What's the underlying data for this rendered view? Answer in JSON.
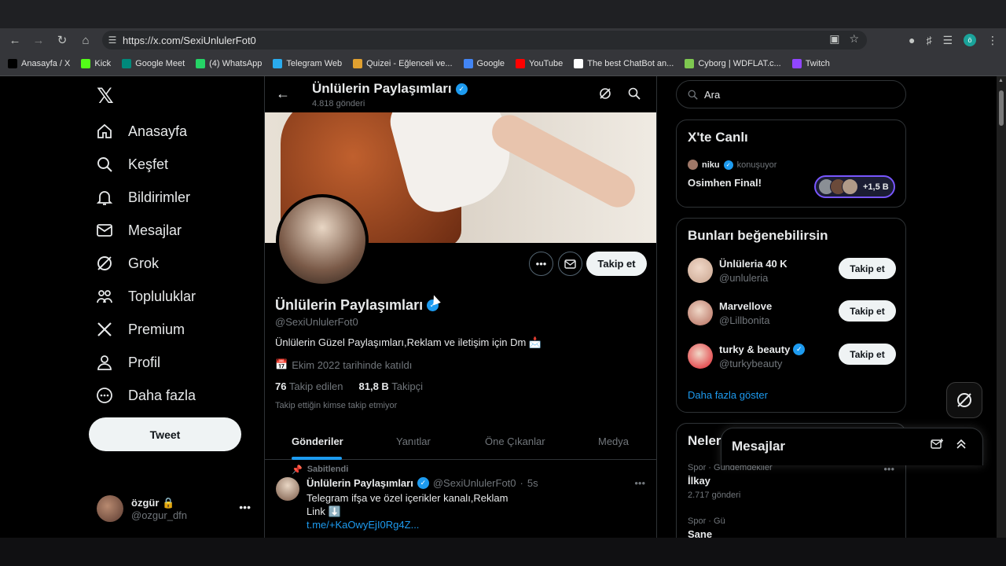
{
  "browser": {
    "url": "https://x.com/SexiUnlulerFot0",
    "profile_initial": "ö",
    "bookmarks": [
      {
        "label": "Anasayfa / X",
        "icon": "x-logo-icon",
        "color": "#000000"
      },
      {
        "label": "Kick",
        "icon": "kick-icon",
        "color": "#53fc18"
      },
      {
        "label": "Google Meet",
        "icon": "meet-icon",
        "color": "#00897b"
      },
      {
        "label": "(4) WhatsApp",
        "icon": "whatsapp-icon",
        "color": "#25d366"
      },
      {
        "label": "Telegram Web",
        "icon": "telegram-icon",
        "color": "#2aabee"
      },
      {
        "label": "Quizei - Eğlenceli ve...",
        "icon": "quizei-icon",
        "color": "#e0a030"
      },
      {
        "label": "Google",
        "icon": "google-icon",
        "color": "#4285f4"
      },
      {
        "label": "YouTube",
        "icon": "youtube-icon",
        "color": "#ff0000"
      },
      {
        "label": "The best ChatBot an...",
        "icon": "chatbot-icon",
        "color": "#ffffff"
      },
      {
        "label": "Cyborg | WDFLAT.c...",
        "icon": "cyborg-icon",
        "color": "#7ec850"
      },
      {
        "label": "Twitch",
        "icon": "twitch-icon",
        "color": "#9146ff"
      }
    ]
  },
  "nav": {
    "items": [
      {
        "label": "Anasayfa",
        "icon": "home-icon"
      },
      {
        "label": "Keşfet",
        "icon": "search-icon"
      },
      {
        "label": "Bildirimler",
        "icon": "bell-icon"
      },
      {
        "label": "Mesajlar",
        "icon": "mail-icon"
      },
      {
        "label": "Grok",
        "icon": "grok-icon"
      },
      {
        "label": "Topluluklar",
        "icon": "communities-icon"
      },
      {
        "label": "Premium",
        "icon": "x-premium-icon"
      },
      {
        "label": "Profil",
        "icon": "person-icon"
      },
      {
        "label": "Daha fazla",
        "icon": "more-circle-icon"
      }
    ],
    "tweet_label": "Tweet",
    "account": {
      "name": "özgür",
      "handle": "@ozgur_dfn"
    }
  },
  "profile": {
    "header_name": "Ünlülerin Paylaşımları",
    "post_count": "4.818 gönderi",
    "name": "Ünlülerin Paylaşımları",
    "handle": "@SexiUnlulerFot0",
    "bio": "Ünlülerin Güzel Paylaşımları,Reklam ve iletişim için Dm 📩",
    "joined": "Ekim 2022 tarihinde katıldı",
    "following_count": "76",
    "following_label": "Takip edilen",
    "followers_count": "81,8 B",
    "followers_label": "Takipçi",
    "mutual_note": "Takip ettiğin kimse takip etmiyor",
    "follow_label": "Takip et",
    "tabs": [
      "Gönderiler",
      "Yanıtlar",
      "Öne Çıkanlar",
      "Medya"
    ]
  },
  "post": {
    "pinned_label": "Sabitlendi",
    "author": "Ünlülerin Paylaşımları",
    "handle": "@SexiUnlulerFot0",
    "time": "5s",
    "line1": "Telegram ifşa ve özel içerikler kanalı,Reklam",
    "line2": "Link ⬇️",
    "link": "t.me/+KaOwyEjI0Rg4Z..."
  },
  "right": {
    "search_placeholder": "Ara",
    "live": {
      "title": "X'te Canlı",
      "host": "niku",
      "host_status": "konuşuyor",
      "space_title": "Osimhen Final!",
      "listeners": "+1,5 B"
    },
    "suggestions": {
      "title": "Bunları beğenebilirsin",
      "items": [
        {
          "name": "Ünlüleria 40 K",
          "handle": "@unluleria",
          "verified": false,
          "color": "#c9a48e"
        },
        {
          "name": "Marvellove",
          "handle": "@Lillbonita",
          "verified": false,
          "color": "#b36a5a"
        },
        {
          "name": "turky & beauty",
          "handle": "@turkybeauty",
          "verified": true,
          "color": "#e0202a"
        }
      ],
      "button_label": "Takip et",
      "show_more": "Daha fazla göster"
    },
    "trends": {
      "title": "Neler oluyor?",
      "items": [
        {
          "meta": "Spor · Gündemdekiler",
          "name": "İlkay",
          "count": "2.717 gönderi"
        },
        {
          "meta": "Spor · Gü",
          "name": "Sane",
          "count": ""
        }
      ]
    }
  },
  "messages_drawer": {
    "title": "Mesajlar"
  },
  "colors": {
    "accent": "#1d9bf0",
    "background": "#000000",
    "border": "#2f3336",
    "muted": "#71767b"
  }
}
